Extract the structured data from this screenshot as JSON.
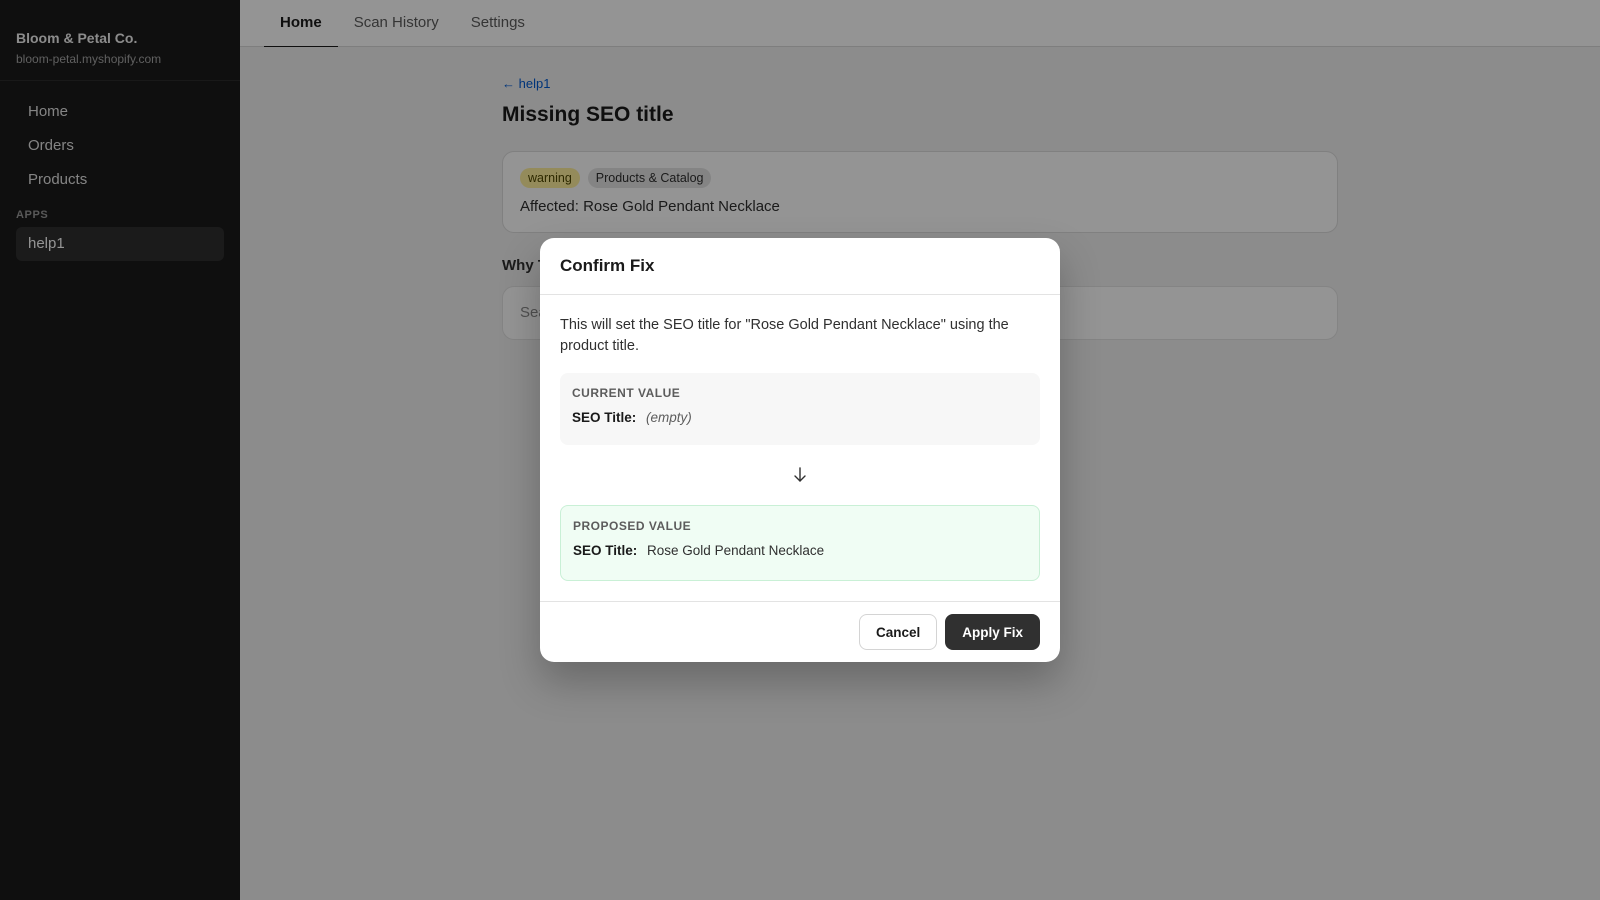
{
  "sidebar": {
    "store_name": "Bloom & Petal Co.",
    "store_domain": "bloom-petal.myshopify.com",
    "items": [
      {
        "label": "Home"
      },
      {
        "label": "Orders"
      },
      {
        "label": "Products"
      }
    ],
    "apps_section": "APPS",
    "apps": [
      {
        "label": "help1"
      }
    ]
  },
  "topnav": {
    "tabs": [
      {
        "label": "Home",
        "active": true
      },
      {
        "label": "Scan History"
      },
      {
        "label": "Settings"
      }
    ]
  },
  "page": {
    "back_label": "← help1",
    "title": "Missing SEO title",
    "badges": {
      "severity": "warning",
      "category": "Products & Catalog"
    },
    "affected": "Affected: Rose Gold Pendant Necklace",
    "section_title": "Why T",
    "section_body": "Sea"
  },
  "modal": {
    "title": "Confirm Fix",
    "description": "This will set the SEO title for \"Rose Gold Pendant Necklace\" using the product title.",
    "current": {
      "label": "CURRENT VALUE",
      "key": "SEO Title:",
      "value": "(empty)"
    },
    "arrow_icon": "arrow-down-icon",
    "proposed": {
      "label": "PROPOSED VALUE",
      "key": "SEO Title:",
      "value": "Rose Gold Pendant Necklace"
    },
    "cancel_label": "Cancel",
    "apply_label": "Apply Fix"
  },
  "colors": {
    "sidebar_bg": "#1a1a1a",
    "primary_button": "#303030",
    "warning_badge": "#ffef9d",
    "proposed_bg": "#f0fdf4",
    "link": "#005bd3"
  }
}
